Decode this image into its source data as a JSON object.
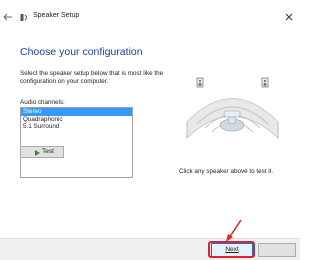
{
  "window": {
    "title": "Speaker Setup",
    "back_icon": "back-arrow-icon",
    "close_icon": "close-icon"
  },
  "page": {
    "heading": "Choose your configuration",
    "description": "Select the speaker setup below that is most like the configuration on your computer.",
    "channels_label": "Audio channels:",
    "channels": [
      {
        "label": "Stereo",
        "selected": true
      },
      {
        "label": "Quadraphonic",
        "selected": false
      },
      {
        "label": "5.1 Surround",
        "selected": false
      }
    ],
    "test_label": "Test",
    "hint": "Click any speaker above to test it."
  },
  "footer": {
    "next_label": "Next",
    "cancel_label": ""
  },
  "colors": {
    "heading": "#1f3f9c",
    "selection": "#3399ff",
    "highlight": "#e0202a",
    "play": "#2f8f2f"
  }
}
